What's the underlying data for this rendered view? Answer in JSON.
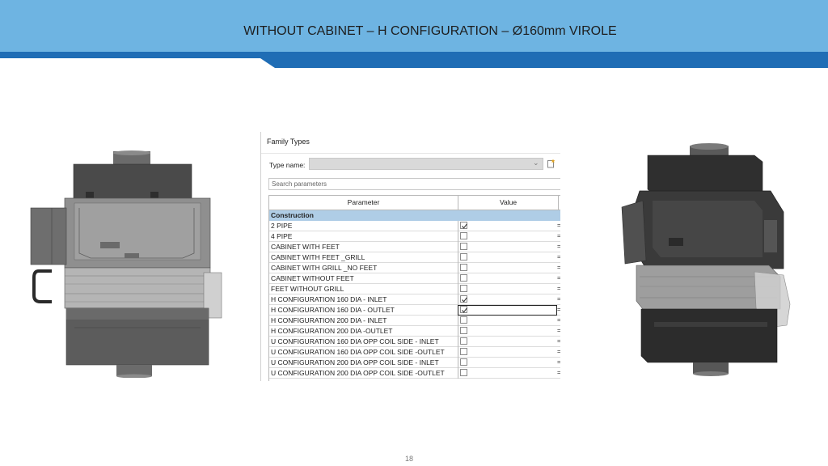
{
  "slide": {
    "title": "WITHOUT CABINET – H CONFIGURATION – Ø160mm VIROLE",
    "page_number": "18",
    "colors": {
      "header_light": "#6eb4e2",
      "header_dark": "#1f6db5",
      "group_row": "#afcde6"
    }
  },
  "family_types": {
    "caption": "Family Types",
    "type_name_label": "Type name:",
    "type_name_value": "",
    "search_placeholder": "Search parameters",
    "columns": {
      "parameter": "Parameter",
      "value": "Value"
    },
    "group": "Construction",
    "rows": [
      {
        "name": "2 PIPE",
        "checked": true,
        "eq": "="
      },
      {
        "name": "4 PIPE",
        "checked": false,
        "eq": "="
      },
      {
        "name": "CABINET WITH FEET",
        "checked": false,
        "eq": "="
      },
      {
        "name": "CABINET WITH FEET _GRILL",
        "checked": false,
        "eq": "="
      },
      {
        "name": "CABINET WITH GRILL _NO FEET",
        "checked": false,
        "eq": "="
      },
      {
        "name": "CABINET WITHOUT FEET",
        "checked": false,
        "eq": "="
      },
      {
        "name": "FEET WITHOUT GRILL",
        "checked": false,
        "eq": "="
      },
      {
        "name": "H CONFIGURATION 160 DIA - INLET",
        "checked": true,
        "eq": "="
      },
      {
        "name": "H CONFIGURATION 160 DIA - OUTLET",
        "checked": true,
        "eq": "=",
        "selected": true
      },
      {
        "name": "H CONFIGURATION 200 DIA - INLET",
        "checked": false,
        "eq": "="
      },
      {
        "name": "H CONFIGURATION 200 DIA -OUTLET",
        "checked": false,
        "eq": "="
      },
      {
        "name": "U CONFIGURATION 160 DIA OPP  COIL SIDE - INLET",
        "checked": false,
        "eq": "="
      },
      {
        "name": "U CONFIGURATION 160 DIA OPP  COIL SIDE -OUTLET",
        "checked": false,
        "eq": "="
      },
      {
        "name": "U CONFIGURATION 200 DIA OPP COIL SIDE - INLET",
        "checked": false,
        "eq": "="
      },
      {
        "name": "U CONFIGURATION 200 DIA OPP COIL SIDE -OUTLET",
        "checked": false,
        "eq": "="
      }
    ],
    "icons": {
      "dropdown": "chevron-down-icon",
      "new_type": "new-type-icon",
      "check": "check-icon"
    }
  },
  "images": {
    "left": "front-view-unit-render",
    "right": "isometric-view-unit-render"
  }
}
